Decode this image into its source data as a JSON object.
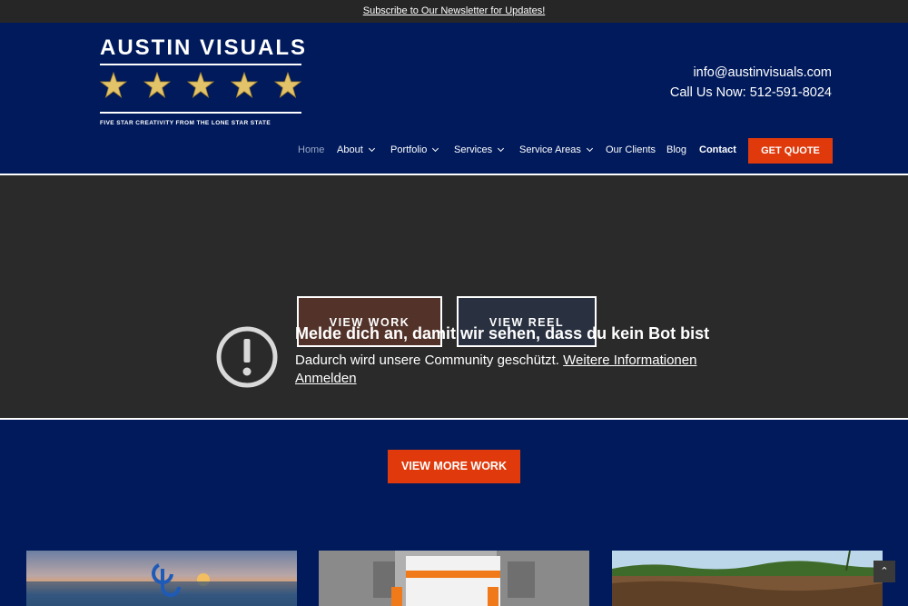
{
  "topbar": {
    "newsletter_link": "Subscribe to Our Newsletter for Updates!"
  },
  "logo": {
    "title": "AUSTIN VISUALS",
    "tagline": "FIVE STAR CREATIVITY FROM THE LONE STAR STATE"
  },
  "contact": {
    "email": "info@austinvisuals.com",
    "phone": "Call Us Now: 512-591-8024"
  },
  "nav": {
    "items": [
      {
        "label": "Home"
      },
      {
        "label": "About"
      },
      {
        "label": "Portfolio"
      },
      {
        "label": "Services"
      },
      {
        "label": "Service Areas"
      },
      {
        "label": "Our Clients"
      },
      {
        "label": "Blog"
      },
      {
        "label": "Contact"
      }
    ],
    "quote_label": "GET QUOTE"
  },
  "video": {
    "view_work_label": "VIEW WORK",
    "view_reel_label": "VIEW REEL",
    "alert_title": "Melde dich an, damit wir sehen, dass du kein Bot bist",
    "alert_text": "Dadurch wird unsere Community geschützt.",
    "alert_link": "Weitere Informationen",
    "alert_signin": "Anmelden"
  },
  "main": {
    "more_work_label": "VIEW MORE WORK"
  },
  "scroll_top_icon": "chevron-up-icon",
  "colors": {
    "brand_navy": "#001a5c",
    "accent_orange": "#e03a0c",
    "topbar": "#262626"
  }
}
